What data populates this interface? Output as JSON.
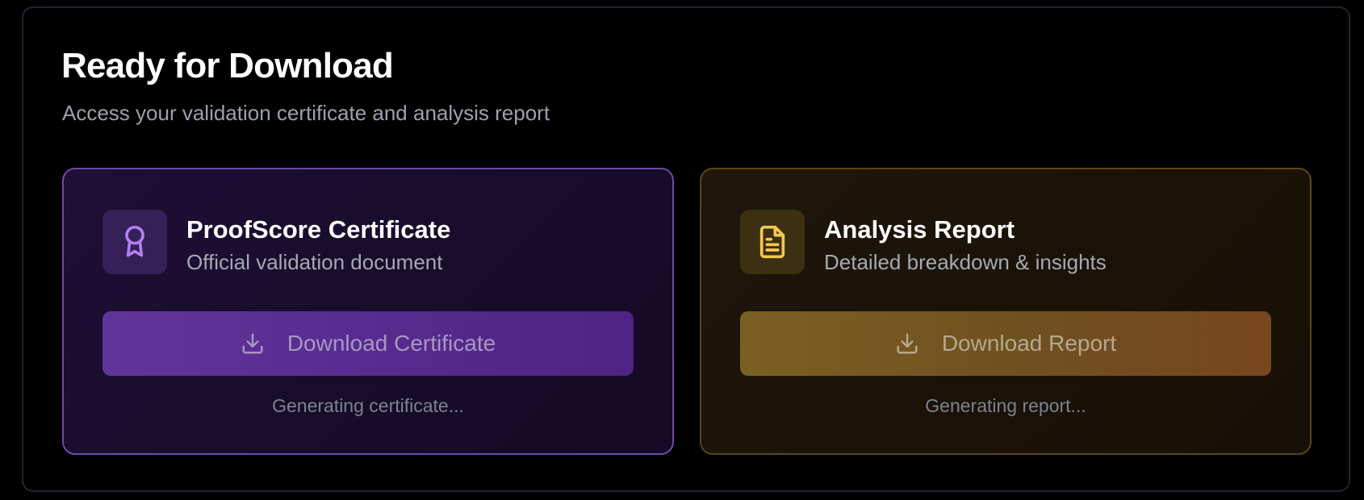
{
  "header": {
    "title": "Ready for Download",
    "subtitle": "Access your validation certificate and analysis report"
  },
  "cards": [
    {
      "title": "ProofScore Certificate",
      "description": "Official validation document",
      "icon": "award-ribbon-icon",
      "button_label": "Download Certificate",
      "button_icon": "download-icon",
      "status": "Generating certificate...",
      "accent_color": "#b07ff0"
    },
    {
      "title": "Analysis Report",
      "description": "Detailed breakdown & insights",
      "icon": "document-icon",
      "button_label": "Download Report",
      "button_icon": "download-icon",
      "status": "Generating report...",
      "accent_color": "#f2c94c"
    }
  ]
}
